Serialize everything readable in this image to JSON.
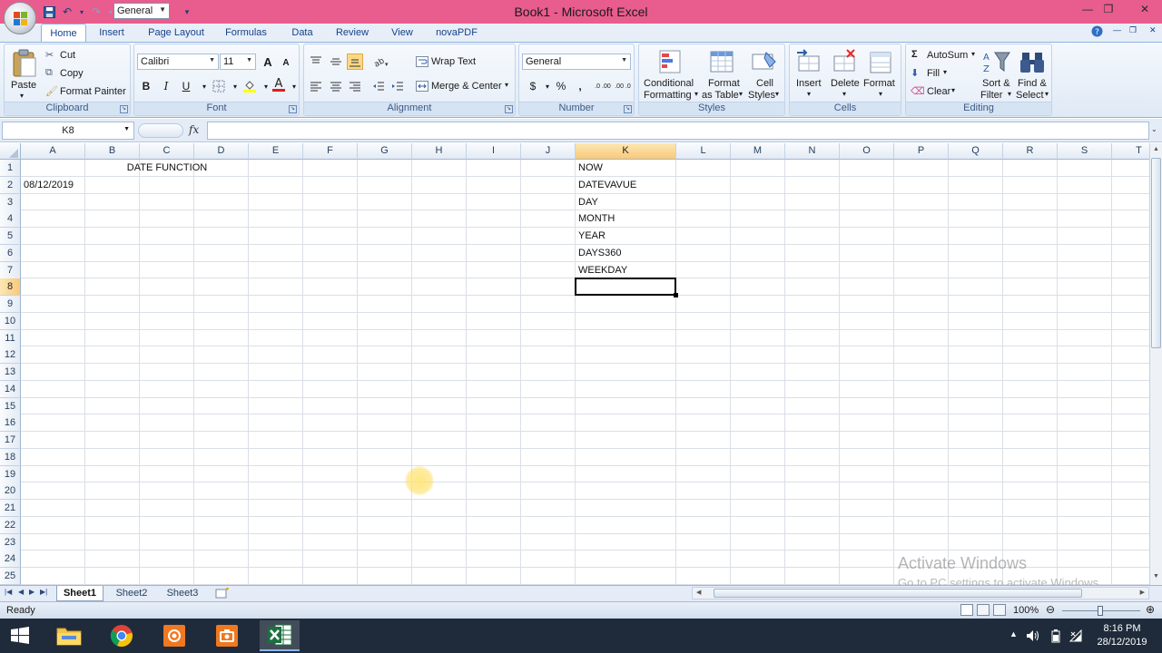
{
  "window": {
    "title": "Book1 - Microsoft Excel",
    "qat_format": "General",
    "controls": {
      "minimize": "—",
      "restore": "❐",
      "close": "✕"
    },
    "doc_controls": {
      "minimize": "—",
      "restore": "❐",
      "close": "✕"
    }
  },
  "tabs": [
    "Home",
    "Insert",
    "Page Layout",
    "Formulas",
    "Data",
    "Review",
    "View",
    "novaPDF"
  ],
  "active_tab": "Home",
  "ribbon": {
    "clipboard": {
      "label": "Clipboard",
      "paste": "Paste",
      "cut": "Cut",
      "copy": "Copy",
      "format_painter": "Format Painter"
    },
    "font": {
      "label": "Font",
      "name": "Calibri",
      "size": "11",
      "bold": "B",
      "italic": "I",
      "underline": "U",
      "grow": "A",
      "shrink": "A"
    },
    "alignment": {
      "label": "Alignment",
      "wrap_text": "Wrap Text",
      "merge_center": "Merge & Center"
    },
    "number": {
      "label": "Number",
      "format": "General",
      "currency": "$",
      "percent": "%",
      "comma": ",",
      "inc_decimal": ".0 .00",
      "dec_decimal": ".00 .0"
    },
    "styles": {
      "label": "Styles",
      "conditional": "Conditional",
      "conditional2": "Formatting",
      "format_table": "Format",
      "format_table2": "as Table",
      "cell_styles": "Cell",
      "cell_styles2": "Styles"
    },
    "cells": {
      "label": "Cells",
      "insert": "Insert",
      "delete": "Delete",
      "format": "Format"
    },
    "editing": {
      "label": "Editing",
      "autosum": "AutoSum",
      "fill": "Fill",
      "clear": "Clear",
      "sort": "Sort &",
      "sort2": "Filter",
      "find": "Find &",
      "find2": "Select"
    }
  },
  "formula_bar": {
    "name_box": "K8",
    "fx": "fx",
    "value": ""
  },
  "columns": [
    "A",
    "B",
    "C",
    "D",
    "E",
    "F",
    "G",
    "H",
    "I",
    "J",
    "K",
    "L",
    "M",
    "N",
    "O",
    "P",
    "Q",
    "R",
    "S",
    "T"
  ],
  "rows": [
    "1",
    "2",
    "3",
    "4",
    "5",
    "6",
    "7",
    "8",
    "9",
    "10",
    "11",
    "12",
    "13",
    "14",
    "15",
    "16",
    "17",
    "18",
    "19",
    "20",
    "21",
    "22",
    "23",
    "24",
    "25"
  ],
  "cells": {
    "A2": "08/12/2019",
    "B1": "DATE FUNCTION",
    "K1": "NOW",
    "K2": "DATEVAVUE",
    "K3": "DAY",
    "K4": "MONTH",
    "K5": "YEAR",
    "K6": "DAYS360",
    "K7": "WEEKDAY"
  },
  "selected_cell": "K8",
  "selected_column": "K",
  "selected_row": "8",
  "sheets": [
    "Sheet1",
    "Sheet2",
    "Sheet3"
  ],
  "active_sheet": "Sheet1",
  "status": {
    "ready": "Ready",
    "zoom": "100%"
  },
  "watermark": {
    "line1": "Activate Windows",
    "line2": "Go to PC settings to activate Windows."
  },
  "clock": {
    "time": "8:16 PM",
    "date": "28/12/2019"
  },
  "colors": {
    "titlebar": "#e85d8d",
    "accent": "#15428b",
    "selection_header": "#f9c979",
    "taskbar": "#1f2b3a"
  }
}
